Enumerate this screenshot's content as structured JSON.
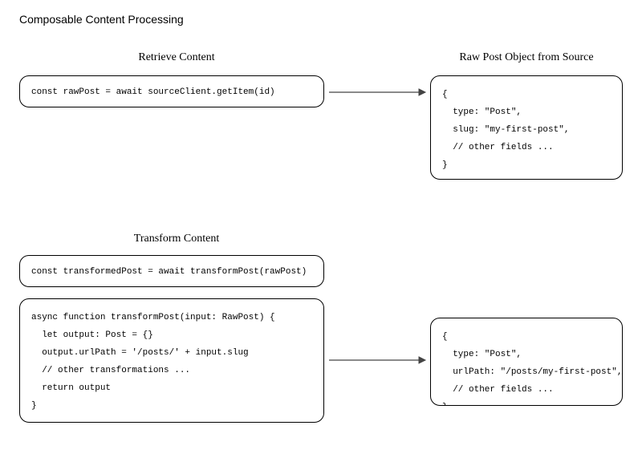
{
  "title": "Composable Content Processing",
  "section1": {
    "left_label": "Retrieve Content",
    "right_label": "Raw Post Object from Source",
    "left_box": "const rawPost = await sourceClient.getItem(id)",
    "right_box": "{\n  type: \"Post\",\n  slug: \"my-first-post\",\n  // other fields ...\n}"
  },
  "section2": {
    "label": "Transform Content",
    "top_box": "const transformedPost = await transformPost(rawPost)",
    "left_box": "async function transformPost(input: RawPost) {\n  let output: Post = {}\n  output.urlPath = '/posts/' + input.slug\n  // other transformations ...\n  return output\n}",
    "right_box": "{\n  type: \"Post\",\n  urlPath: \"/posts/my-first-post\",\n  // other fields ...\n}"
  }
}
